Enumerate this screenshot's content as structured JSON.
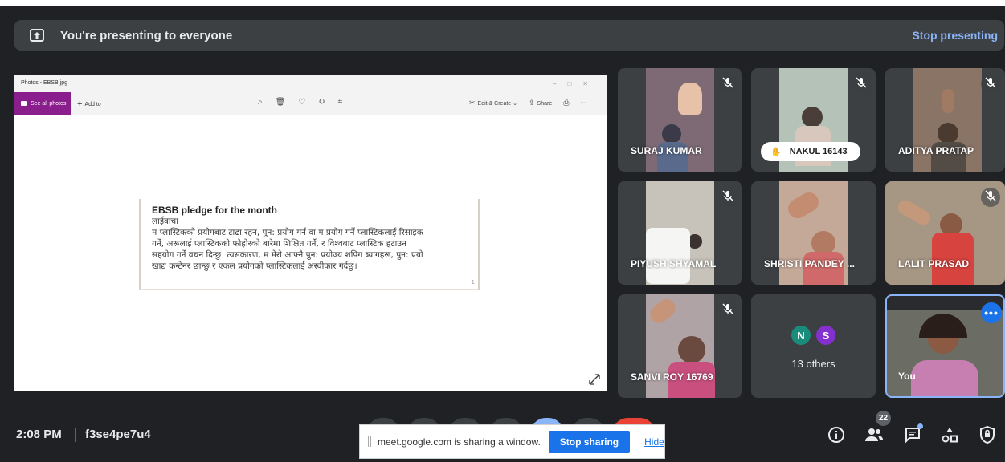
{
  "banner": {
    "text": "You're presenting to everyone",
    "stop_label": "Stop presenting"
  },
  "shared_window": {
    "title": "Photos - EBSB.jpg",
    "see_all_label": "See all photos",
    "add_to_label": "Add to",
    "edit_create_label": "Edit & Create",
    "share_label": "Share",
    "pledge": {
      "title": "EBSB pledge for the month",
      "lines": [
        "लाईवाचा",
        "म प्लास्टिकको प्रयोगबाट टाढा रहन, पुन: प्रयोग गर्न वा म प्रयोग गर्ने प्लास्टिकलाई रिसाइक",
        "गर्ने, अरूलाई प्लास्टिकको फोहोरको बारेमा शिक्षित गर्ने, र विश्वबाट प्लास्टिक हटाउन",
        "सहयोग गर्ने वचन दिन्छु। त्यसकारण, म मेरो आफ्नै पुन: प्रयोज्य शपिंग ब्यागहरू, पुन: प्रयो",
        "खाद्य कन्टेनर छान्छु र एकल प्रयोगको प्लास्टिकलाई अस्वीकार गर्दछु।"
      ],
      "page_num": "1"
    }
  },
  "participants": [
    {
      "name": "SURAJ KUMAR"
    },
    {
      "name": "NAKUL 16143"
    },
    {
      "name": "ADITYA PRATAP"
    },
    {
      "name": "PIYUSH SHYAMAL"
    },
    {
      "name": "SHRISTI PANDEY ..."
    },
    {
      "name": "LALIT PRASAD"
    },
    {
      "name": "SANVI ROY 16769"
    }
  ],
  "others": {
    "avatars": [
      {
        "letter": "N",
        "color": "#1a8c7c"
      },
      {
        "letter": "S",
        "color": "#8430ce"
      }
    ],
    "count_label": "13 others"
  },
  "self_tile": {
    "name": "You"
  },
  "bottom": {
    "time": "2:08 PM",
    "meeting_code": "f3se4pe7u4",
    "people_count": "22"
  },
  "share_notice": {
    "message": "meet.google.com is sharing a window.",
    "stop_label": "Stop sharing",
    "hide_label": "Hide"
  },
  "colors": {
    "background": "#202124",
    "tile": "#3c4043",
    "accent_blue": "#1a73e8",
    "link_blue": "#8ab4f8",
    "photos_purple": "#8a1e8c"
  }
}
